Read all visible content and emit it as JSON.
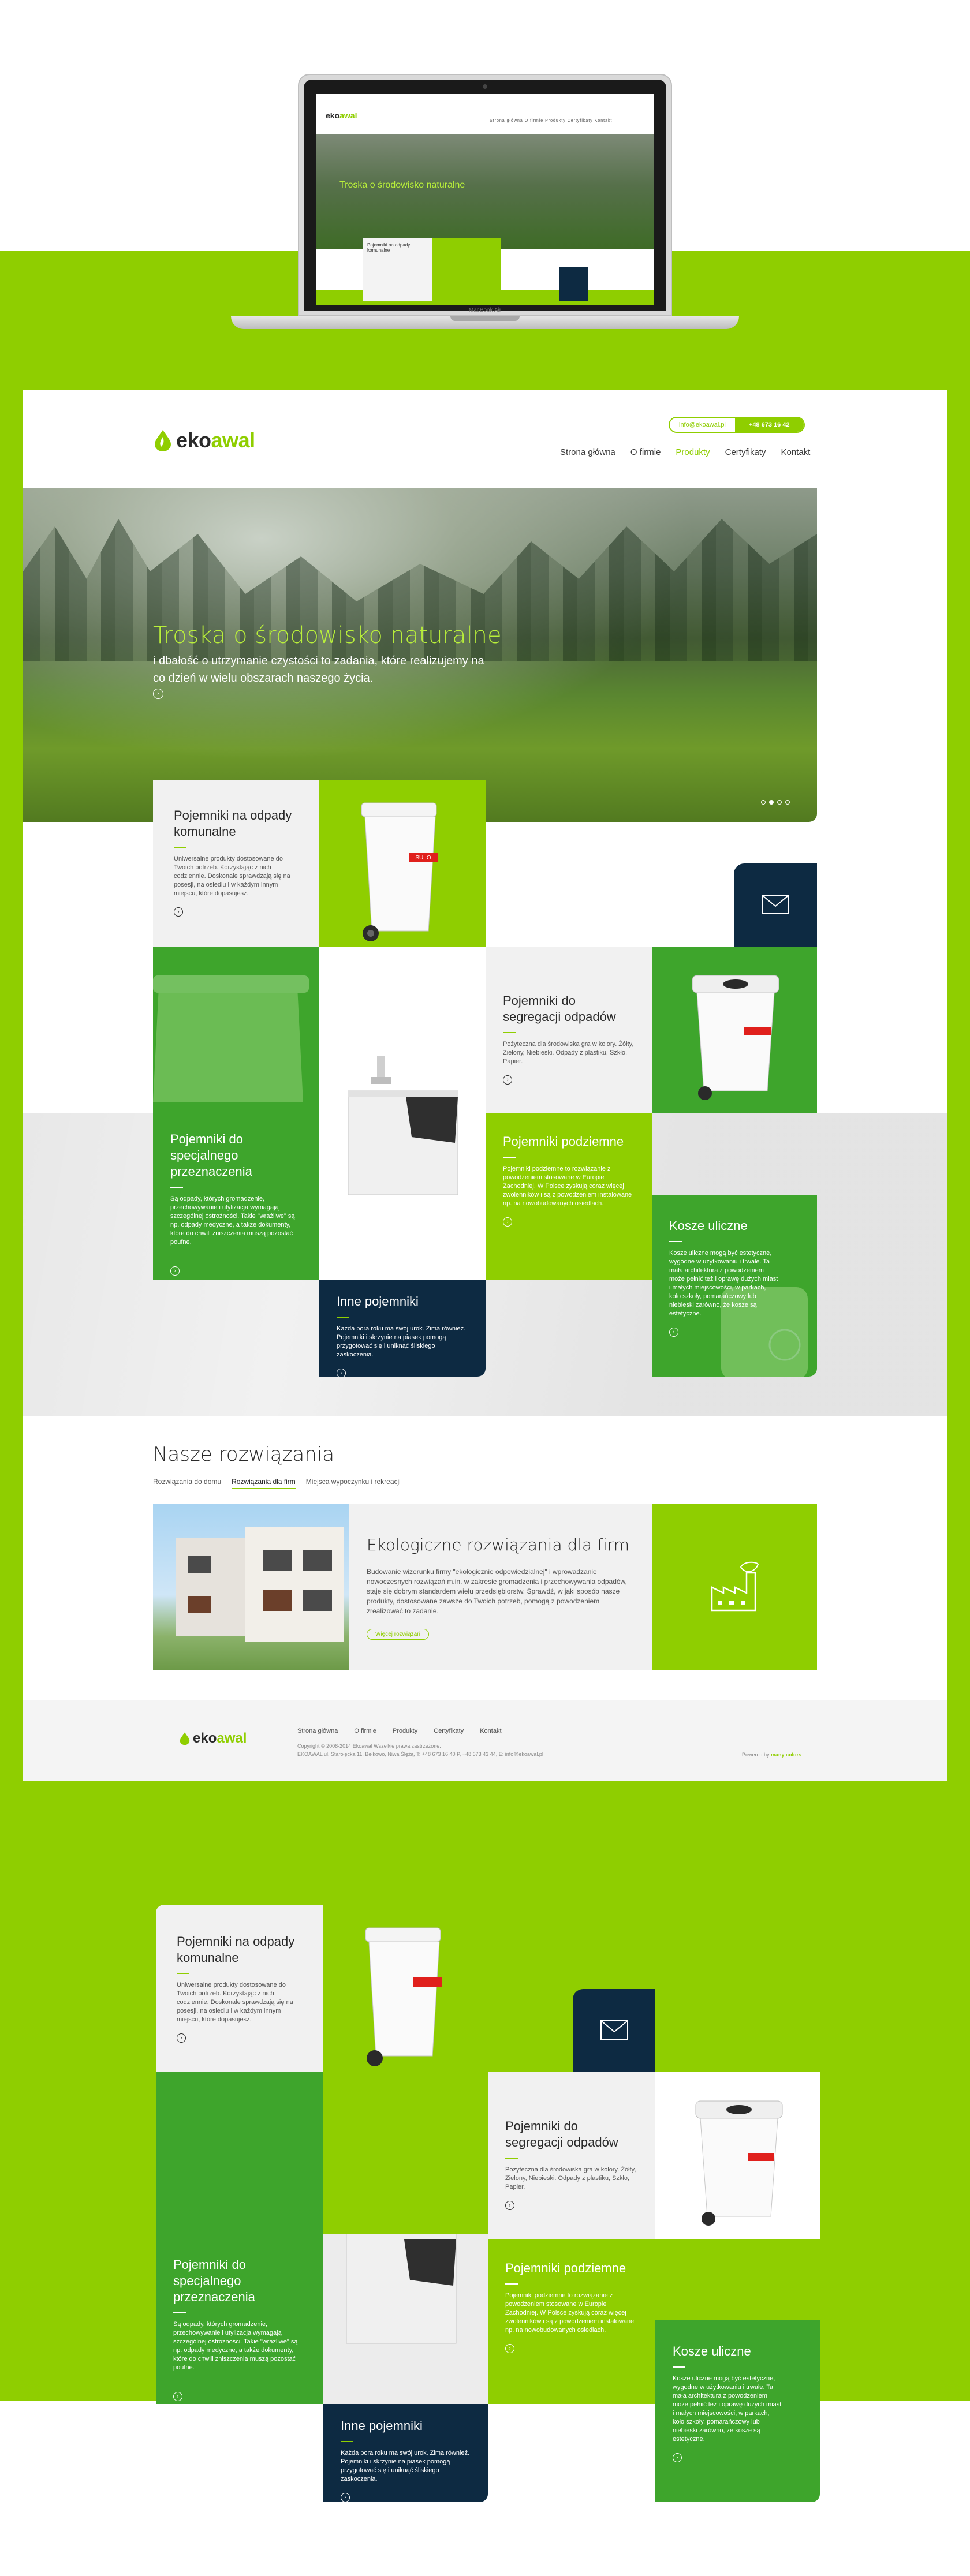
{
  "brand": {
    "name_a": "eko",
    "name_b": "awal",
    "green": "#8fce00",
    "navy": "#0d2a42",
    "dark_green": "#3ea52c"
  },
  "laptop": {
    "label": "MacBook Air",
    "mini_nav": "Strona główna  O firmie  Produkty  Certyfikaty  Kontakt",
    "mini_hero_title": "Troska o środowisko naturalne",
    "mini_card_title": "Pojemniki na odpady komunalne"
  },
  "header": {
    "email": "info@ekoawal.pl",
    "phone": "+48 673 16 42",
    "nav": [
      "Strona główna",
      "O firmie",
      "Produkty",
      "Certyfikaty",
      "Kontakt"
    ],
    "nav_active": "Produkty"
  },
  "hero": {
    "title": "Troska o środowisko naturalne",
    "subtitle": "i dbałość o utrzymanie czystości to zadania, które realizujemy na co dzień w wielu obszarach naszego życia.",
    "arrow": "›"
  },
  "tiles": {
    "komunalne": {
      "title": "Pojemniki na odpady komunalne",
      "text": "Uniwersalne produkty dostosowane do Twoich potrzeb. Korzystając z nich codziennie. Doskonale sprawdzają się na posesji, na osiedlu i w każdym innym miejscu, które dopasujesz.",
      "arrow": "›"
    },
    "segregacja": {
      "title": "Pojemniki do segregacji odpadów",
      "text": "Pożyteczna dla środowiska gra w kolory. Żółty, Zielony, Niebieski. Odpady z plastiku, Szkło, Papier.",
      "arrow": "›"
    },
    "specjalne": {
      "title": "Pojemniki do specjalnego przeznaczenia",
      "text": "Są odpady, których gromadzenie, przechowywanie i utylizacja wymagają szczególnej ostrożności. Takie \"wrażliwe\" są np. odpady medyczne, a także dokumenty, które do chwili zniszczenia muszą pozostać poufne.",
      "arrow": "›"
    },
    "podziemne": {
      "title": "Pojemniki podziemne",
      "text": "Pojemniki podziemne to rozwiązanie z powodzeniem stosowane w Europie Zachodniej. W Polsce zyskują coraz więcej zwolenników i są z powodzeniem instalowane np. na nowobudowanych osiedlach.",
      "arrow": "›"
    },
    "inne": {
      "title": "Inne pojemniki",
      "text": "Każda pora roku ma swój urok. Zima również. Pojemniki i skrzynie na piasek pomogą przygotować się i uniknąć śliskiego zaskoczenia.",
      "arrow": "›"
    },
    "kosze": {
      "title": "Kosze uliczne",
      "text": "Kosze uliczne mogą być estetyczne, wygodne w użytkowaniu i trwałe. Ta mała architektura z powodzeniem może pełnić też i oprawę dużych miast i małych miejscowości, w parkach, koło szkoły, pomarańczowy lub niebieski zarówno, że kosze są estetyczne.",
      "arrow": "›"
    },
    "bin_label": "SULO"
  },
  "solutions": {
    "title": "Nasze rozwiązania",
    "tabs": [
      "Rozwiązania do domu",
      "Rozwiązania dla firm",
      "Miejsca wypoczynku i rekreacji"
    ],
    "active_tab": "Rozwiązania dla firm",
    "heading": "Ekologiczne rozwiązania dla firm",
    "text": "Budowanie wizerunku firmy \"ekologicznie odpowiedzialnej\" i wprowadzanie nowoczesnych rozwiązań m.in. w zakresie gromadzenia i przechowywania odpadów, staje się dobrym standardem wielu przedsiębiorstw. Sprawdź, w jaki sposób nasze produkty, dostosowane zawsze do Twoich potrzeb, pomogą z powodzeniem zrealizować to zadanie.",
    "button": "Więcej rozwiązań"
  },
  "footer": {
    "nav": [
      "Strona główna",
      "O firmie",
      "Produkty",
      "Certyfikaty",
      "Kontakt"
    ],
    "copy1": "Copyright © 2008-2014 Ekoawal Wszelkie prawa zastrzeżone.",
    "copy2": "EKOAWAL ul. Starołęcka 11, Bełkowo, Niwa Ślężą, T: +48 673 16 40 P, +48 673 43 44, E: info@ekoawal.pl",
    "powered_label": "Powered by",
    "powered_by": "many colors"
  }
}
